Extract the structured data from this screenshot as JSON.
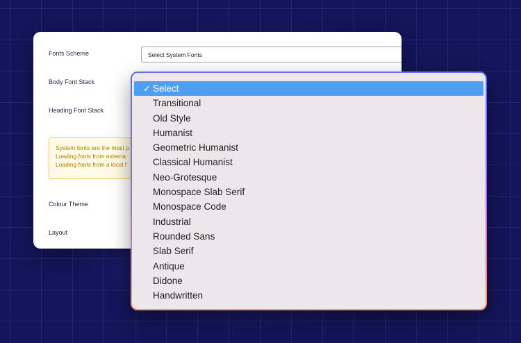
{
  "settings": {
    "fonts_scheme_label": "Fonts Scheme",
    "fonts_scheme_value": "Select System Fonts",
    "body_font_label": "Body Font Stack",
    "heading_font_label": "Heading Font Stack",
    "notice_lines": [
      "System fonts are the most p",
      "Loading fonts from externa",
      "Loading fonts from a local f"
    ],
    "colour_theme_label": "Colour Theme",
    "layout_label": "Layout"
  },
  "dropdown": {
    "check_glyph": "✓",
    "options": [
      "Select",
      "Transitional",
      "Old Style",
      "Humanist",
      "Geometric Humanist",
      "Classical Humanist",
      "Neo-Grotesque",
      "Monospace Slab Serif",
      "Monospace Code",
      "Industrial",
      "Rounded Sans",
      "Slab Serif",
      "Antique",
      "Didone",
      "Handwritten"
    ],
    "selected_index": 0
  },
  "colors": {
    "background": "#14155a",
    "selected_option": "#4e9ff2",
    "notice_text": "#b07a00"
  }
}
